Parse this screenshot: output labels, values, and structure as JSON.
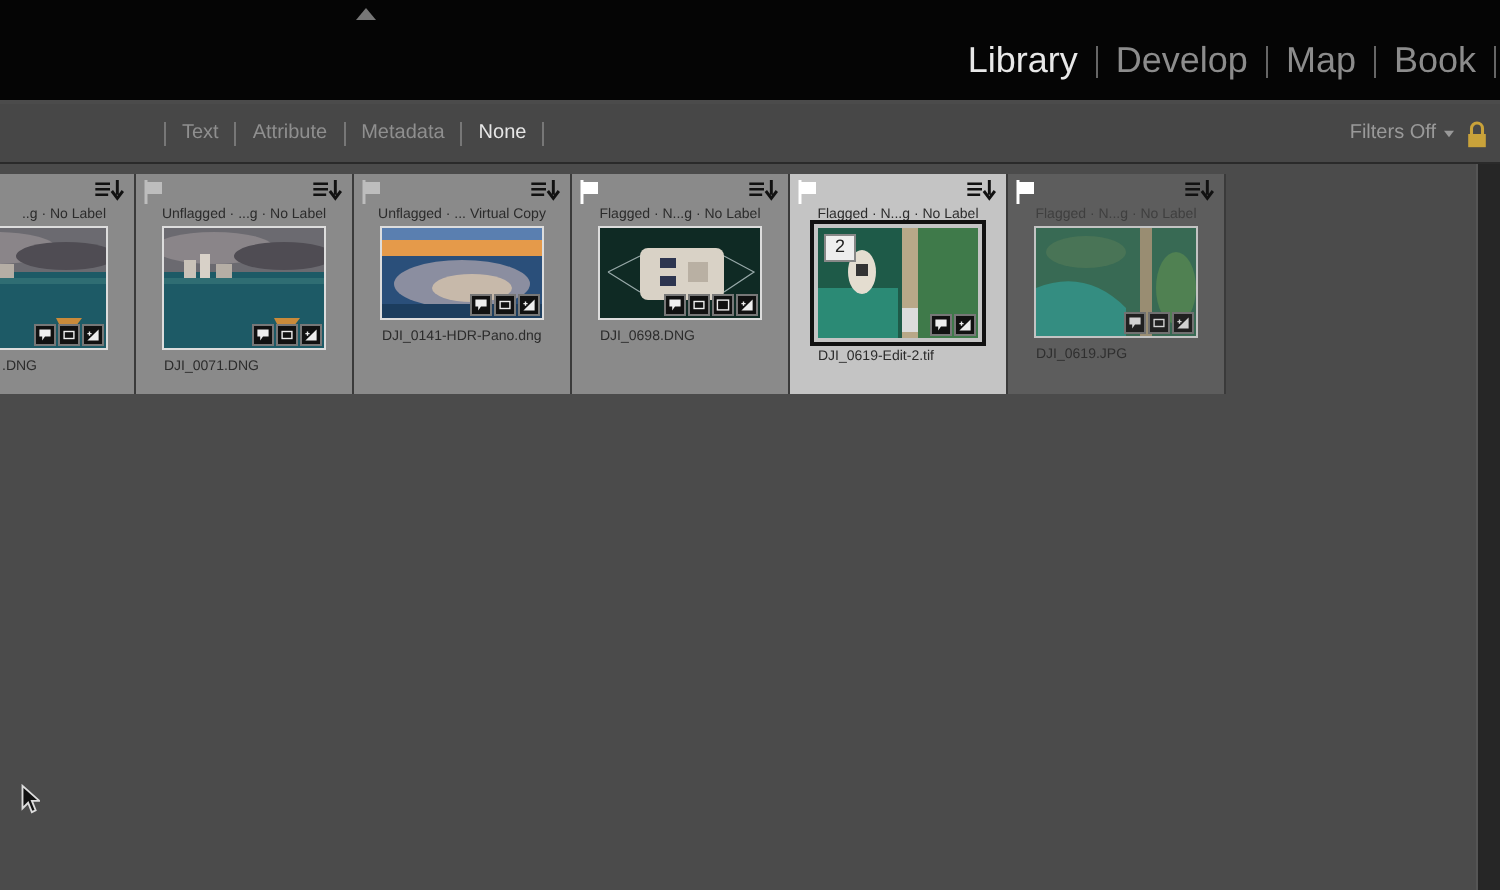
{
  "modules": [
    {
      "label": "Library",
      "selected": true
    },
    {
      "label": "Develop",
      "selected": false
    },
    {
      "label": "Map",
      "selected": false
    },
    {
      "label": "Book",
      "selected": false
    }
  ],
  "filter_bar": {
    "tabs": [
      {
        "label": "Text",
        "selected": false
      },
      {
        "label": "Attribute",
        "selected": false
      },
      {
        "label": "Metadata",
        "selected": false
      },
      {
        "label": "None",
        "selected": true
      }
    ],
    "filters": "Filters Off",
    "locked": true
  },
  "grid": [
    {
      "header": "..g · No Label",
      "filename": ".DNG",
      "selected": false,
      "dimmed": false,
      "badges": [
        {
          "kind": "comment"
        },
        {
          "kind": "crop"
        },
        {
          "kind": "develop"
        }
      ]
    },
    {
      "header": "Unflagged · ...g · No Label",
      "filename": "DJI_0071.DNG",
      "flagged": false,
      "selected": false,
      "dimmed": false,
      "badges": [
        {
          "kind": "comment"
        },
        {
          "kind": "crop"
        },
        {
          "kind": "develop"
        }
      ]
    },
    {
      "header": "Unflagged · ... Virtual Copy",
      "filename": "DJI_0141-HDR-Pano.dng",
      "flagged": false,
      "selected": false,
      "dimmed": false,
      "badges": [
        {
          "kind": "comment"
        },
        {
          "kind": "crop"
        },
        {
          "kind": "develop"
        }
      ]
    },
    {
      "header": "Flagged · N...g · No Label",
      "filename": "DJI_0698.DNG",
      "flagged": true,
      "selected": false,
      "dimmed": false,
      "badges": [
        {
          "kind": "comment"
        },
        {
          "kind": "crop"
        },
        {
          "kind": "frame"
        },
        {
          "kind": "develop"
        }
      ]
    },
    {
      "header": "Flagged · N...g · No Label",
      "filename": "DJI_0619-Edit-2.tif",
      "flagged": true,
      "selected": true,
      "dimmed": false,
      "stack": "2",
      "badges": [
        {
          "kind": "comment"
        },
        {
          "kind": "develop"
        }
      ]
    },
    {
      "header": "Flagged · N...g · No Label",
      "filename": "DJI_0619.JPG",
      "flagged": true,
      "selected": false,
      "dimmed": true,
      "badges": [
        {
          "kind": "comment"
        },
        {
          "kind": "crop"
        },
        {
          "kind": "develop"
        }
      ]
    }
  ]
}
